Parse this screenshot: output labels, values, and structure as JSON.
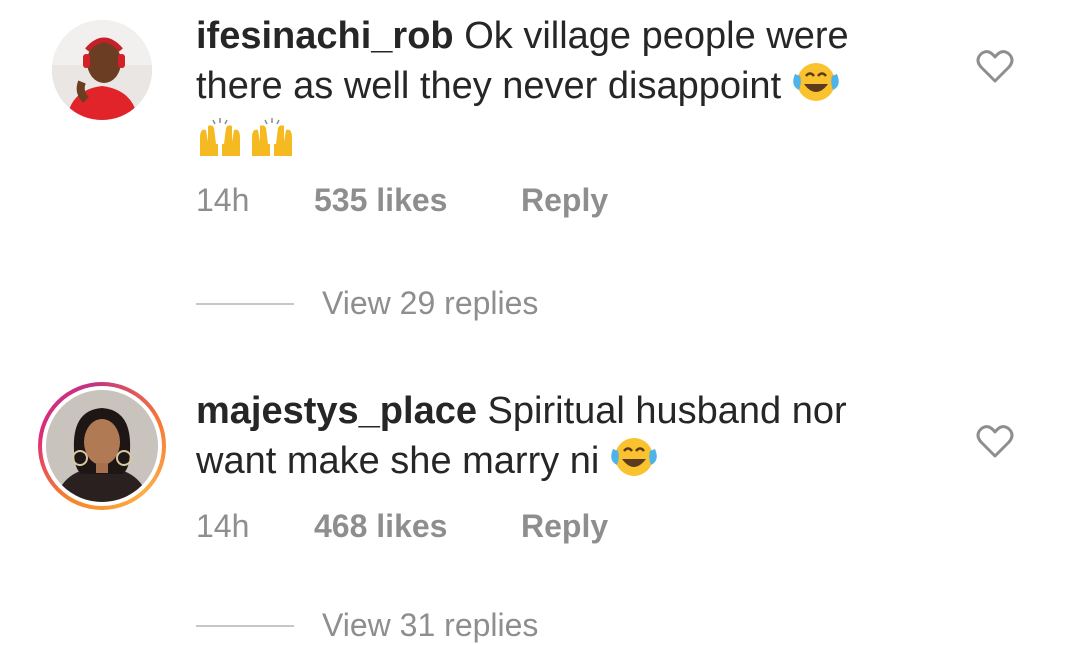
{
  "comments": [
    {
      "username": "ifesinachi_rob",
      "text_line1": "Ok village people were",
      "text_line2": "there as well they never disappoint",
      "emoji_laugh": "😂",
      "emoji_raised_hands": "🙌🙌",
      "time": "14h",
      "likes": "535 likes",
      "reply_label": "Reply",
      "view_replies": "View 29 replies",
      "has_story_ring": false
    },
    {
      "username": "majestys_place",
      "text_line1": "Spiritual husband nor",
      "text_line2": "want make she marry ni",
      "emoji_laugh": "😂",
      "time": "14h",
      "likes": "468 likes",
      "reply_label": "Reply",
      "view_replies": "View 31 replies",
      "has_story_ring": true
    }
  ],
  "icons": {
    "like": "heart-outline-icon"
  },
  "colors": {
    "text": "#262626",
    "muted": "#8e8e8e",
    "divider": "#c7c7c7",
    "story_ring": [
      "#f58529",
      "#dd2a7b",
      "#fcaf45"
    ]
  }
}
